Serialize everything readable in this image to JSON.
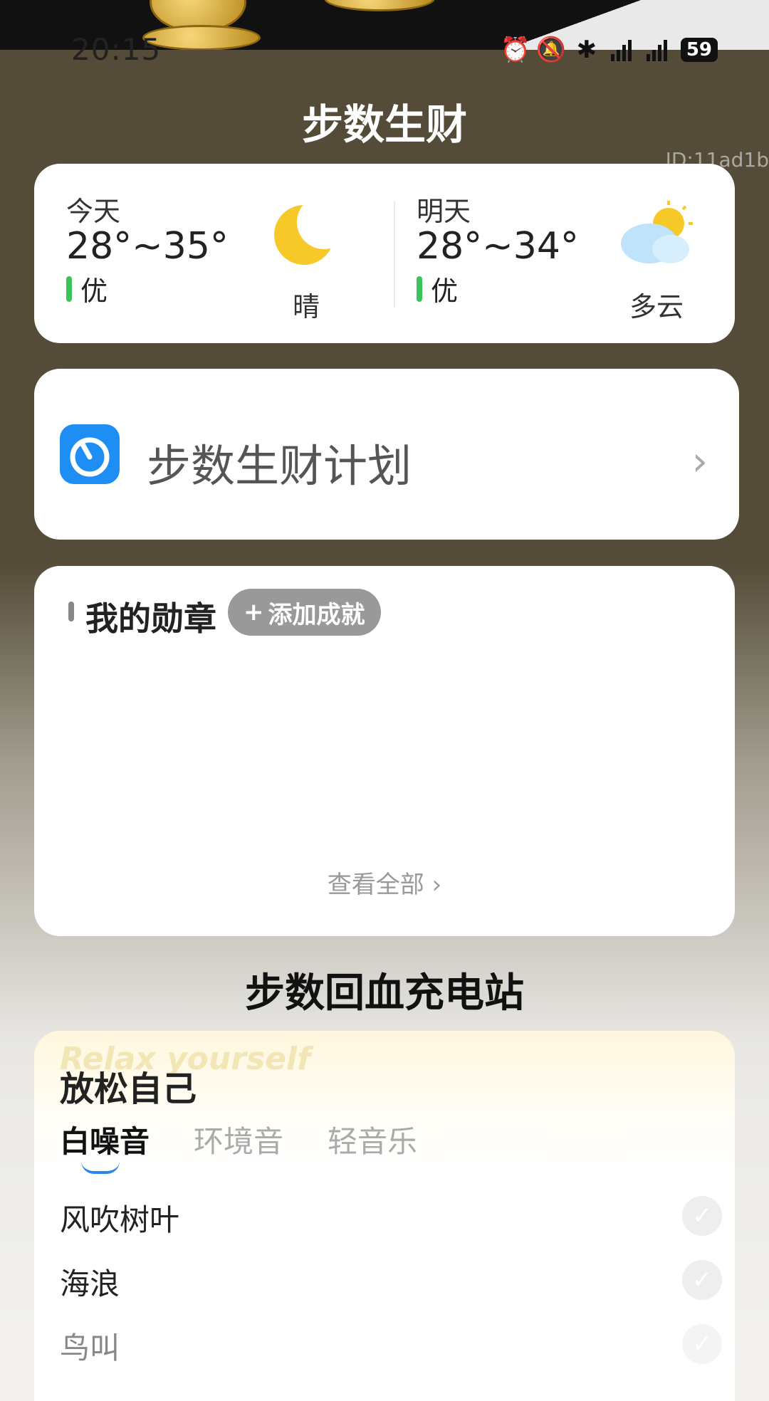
{
  "status_bar": {
    "time": "20:15",
    "battery": "59"
  },
  "page": {
    "title": "步数生财",
    "watermark": "ID:11ad1b"
  },
  "weather": {
    "today": {
      "label": "今天",
      "temp": "28°~35°",
      "air_quality": "优",
      "condition": "晴",
      "icon": "moon-icon"
    },
    "tomorrow": {
      "label": "明天",
      "temp": "28°~34°",
      "air_quality": "优",
      "condition": "多云",
      "icon": "partly-cloudy-icon"
    }
  },
  "plan": {
    "label": "步数生财计划"
  },
  "medals": {
    "title": "我的勋章",
    "add_label": "添加成就",
    "view_all": "查看全部"
  },
  "charging_station": {
    "title": "步数回血充电站"
  },
  "relax": {
    "bg_text": "Relax yourself",
    "title": "放松自己",
    "tabs": [
      "白噪音",
      "环境音",
      "轻音乐"
    ],
    "items": [
      "风吹树叶",
      "海浪",
      "鸟叫"
    ]
  },
  "colors": {
    "header_bg": "#544c38",
    "accent_blue": "#1e8ef5",
    "air_quality_green": "#3cc35a"
  }
}
